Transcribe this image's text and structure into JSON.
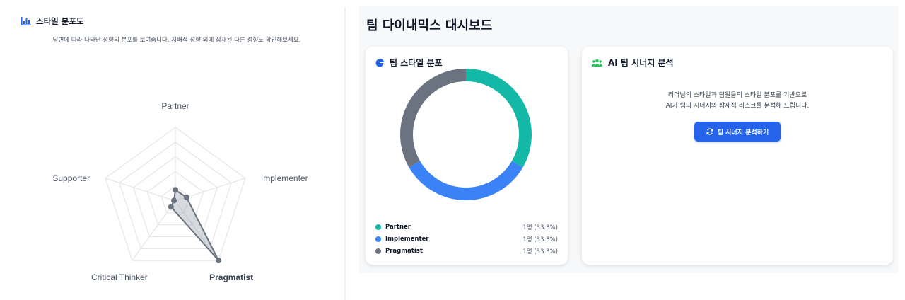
{
  "radar": {
    "title": "스타일 분포도",
    "description": "답변에 따라 나타난 성향의 분포를 보여줍니다. 지배적 성향 외에 잠재된 다른 성향도 확인해보세요.",
    "axes": [
      "Partner",
      "Implementer",
      "Pragmatist",
      "Critical Thinker",
      "Supporter"
    ],
    "highlight_axis": "Pragmatist",
    "values": [
      0.15,
      0.16,
      1.0,
      0.1,
      0.02
    ],
    "levels": 5,
    "colors": {
      "grid": "#e5e7eb",
      "fill": "#9ca3af",
      "line": "#6b7280",
      "icon": "#2563eb"
    }
  },
  "dashboard": {
    "title": "팀 다이내믹스 대시보드",
    "style_card": {
      "title": "팀 스타일 분포",
      "chart_data": {
        "type": "pie",
        "labels": [
          "Partner",
          "Implementer",
          "Pragmatist"
        ],
        "values": [
          1,
          1,
          1
        ],
        "colors": [
          "#14b8a6",
          "#3b82f6",
          "#6b7280"
        ]
      },
      "legend": [
        {
          "name": "Partner",
          "value": "1명 (33.3%)",
          "color": "#14b8a6"
        },
        {
          "name": "Implementer",
          "value": "1명 (33.3%)",
          "color": "#3b82f6"
        },
        {
          "name": "Pragmatist",
          "value": "1명 (33.3%)",
          "color": "#6b7280"
        }
      ]
    },
    "ai_card": {
      "title": "AI 팀 시너지 분석",
      "desc_line1": "리더님의 스타일과 팀원들의 스타일 분포를 기반으로",
      "desc_line2": "AI가 팀의 시너지와 잠재적 리스크를 분석해 드립니다.",
      "button_label": "팀 시너지 분석하기",
      "colors": {
        "button": "#2563eb",
        "icon": "#22c55e"
      }
    }
  }
}
